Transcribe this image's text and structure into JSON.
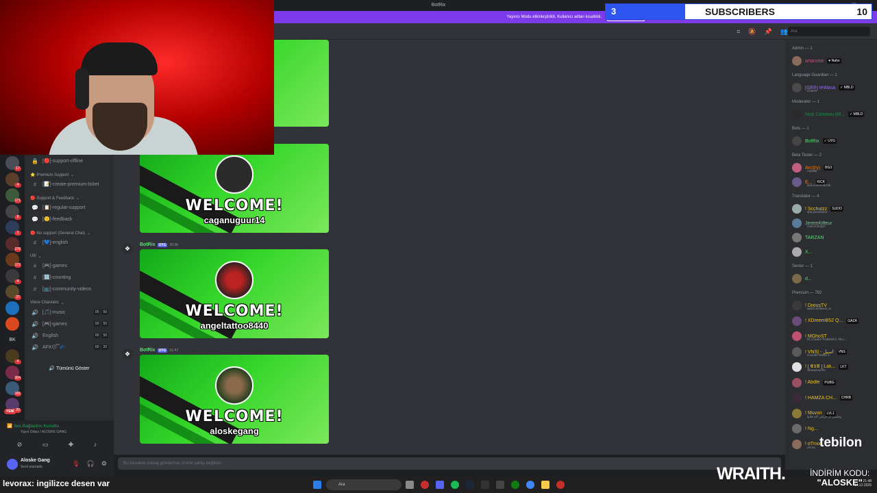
{
  "window": {
    "title": "BotRix"
  },
  "streamer_banner": {
    "text": "Yayıncı Modu etkinleştirildi. Kullanıcı adları kısaltıldı.",
    "button": "Devre dışı bırak"
  },
  "subs_overlay": {
    "current": "3",
    "label": "SUBSCRIBERS",
    "goal": "10",
    "progress_fraction": 0.3,
    "fill_color": "#2f55f0"
  },
  "webcam": {
    "name": "webcam-feed"
  },
  "server_rail": {
    "servers": [
      {
        "badge": "17"
      },
      {
        "badge": "4"
      },
      {
        "badge": "171"
      },
      {
        "badge": "8"
      },
      {
        "badge": "1"
      },
      {
        "badge": "278"
      },
      {
        "badge": "172"
      },
      {
        "badge": "4"
      },
      {
        "badge": "37"
      },
      {
        "badge": ""
      },
      {
        "badge": ""
      },
      {
        "initials": "BK"
      },
      {
        "badge": "4"
      },
      {
        "badge": "304"
      },
      {
        "badge": "165"
      },
      {
        "badge": "20"
      }
    ],
    "new_badge": "YENİ"
  },
  "channels": {
    "items": [
      {
        "kind": "channel",
        "icon": "lock-icon",
        "label": "[🔴]-support-offline"
      },
      {
        "kind": "category",
        "label": "⭐-Premium Support"
      },
      {
        "kind": "channel",
        "icon": "hash-icon",
        "label": "[📝]-create-premium-ticket"
      },
      {
        "kind": "category",
        "label": "🔴-Support & Feedback"
      },
      {
        "kind": "channel",
        "icon": "speech-icon",
        "label": "[📋]-regular-support"
      },
      {
        "kind": "channel",
        "icon": "speech-icon",
        "label": "[🙂]-feedback"
      },
      {
        "kind": "category",
        "label": "🔴-No support (General Chat)"
      },
      {
        "kind": "channel",
        "icon": "hash-icon",
        "label": "[💙]-english"
      },
      {
        "kind": "category",
        "label": "Util"
      },
      {
        "kind": "channel",
        "icon": "hash-icon",
        "label": "[🎮]-games"
      },
      {
        "kind": "channel",
        "icon": "hash-icon",
        "label": "[🔢]-counting"
      },
      {
        "kind": "channel",
        "icon": "hash-icon",
        "label": "[📺]-community-videos"
      },
      {
        "kind": "category",
        "label": "Voice Channels"
      },
      {
        "kind": "voice",
        "icon": "speaker-icon",
        "label": "[🎵]-music",
        "a": "00",
        "b": "50"
      },
      {
        "kind": "voice",
        "icon": "speaker-icon",
        "label": "[🎮]-games",
        "a": "00",
        "b": "50"
      },
      {
        "kind": "voice",
        "icon": "speaker-icon",
        "label": "English",
        "a": "00",
        "b": "50"
      },
      {
        "kind": "voice",
        "icon": "speaker-icon",
        "label": "AFK😴💤",
        "a": "00",
        "b": "20"
      }
    ],
    "show_all": "Tümünü Göster"
  },
  "user_panel": {
    "voice_status": "Ses Bağlantısı Kuruldu",
    "voice_channel": "Yayın Odası / ALOSKE GANG",
    "username": "Aloske Gang",
    "status": "Sesli aramada"
  },
  "chat": {
    "search_placeholder": "Ara",
    "messages": [
      {
        "author": "",
        "app": "",
        "time": "",
        "welcome": "WELCOME!",
        "user": "caganuguur14"
      },
      {
        "author": "BotRix",
        "app": "UYG",
        "time": "20:36",
        "welcome": "WELCOME!",
        "user": "angeltattoo8440"
      },
      {
        "author": "BotRix",
        "app": "UYG",
        "time": "21:47",
        "welcome": "WELCOME!",
        "user": "aloskegang"
      }
    ],
    "composer_placeholder": "Bu kanalda mesaj gönderme iznine sahip değilsin."
  },
  "members": {
    "groups": [
      {
        "title": "Admin — 1",
        "rows": [
          {
            "name": "artanime",
            "tag": "♥ Naho",
            "color": "#e0487a"
          }
        ]
      },
      {
        "title": "Language Guardian — 1",
        "rows": [
          {
            "name": "[GER] leWasa",
            "tag": "✓ MBLD",
            "color": "#9a6cf0",
            "sub": "Cheers"
          }
        ]
      },
      {
        "title": "Moderator — 1",
        "rows": [
          {
            "name": "Nick Comeau (M...",
            "tag": "✓ MBLD",
            "color": "#1f8b4c"
          }
        ]
      },
      {
        "title": "Bots — 1",
        "rows": [
          {
            "name": "BotRix",
            "tag": "✓ UYG",
            "color": "#5ddc7a"
          }
        ]
      },
      {
        "title": "Beta Tester — 2",
        "rows": [
          {
            "name": "Arc(l/y)",
            "tag": "BG3",
            "color": "#e67e22",
            "sub": "royality"
          },
          {
            "name": "E...",
            "tag": "KICK",
            "color": "#e67e22",
            "sub": "kick.com/eddi24k"
          }
        ]
      },
      {
        "title": "Translator — 4",
        "rows": [
          {
            "name": "! Scchutzz",
            "tag": "SUDO",
            "color": "#f1c40f",
            "sub": "vpa.pinoebat.tr"
          },
          {
            "name": "JeremKiffeur",
            "tag": "",
            "color": "#5ddc7a",
            "sub": "Call of Duty®"
          },
          {
            "name": "TARZAN",
            "tag": "",
            "color": "#5ddc7a"
          },
          {
            "name": "X...",
            "tag": "",
            "color": "#5ddc7a"
          }
        ]
      },
      {
        "title": "Senior — 1",
        "rows": [
          {
            "name": "d...",
            "tag": "",
            "color": "#5ddc7a"
          }
        ]
      },
      {
        "title": "Premium — 792",
        "rows": [
          {
            "name": "! DixiusTV",
            "tag": "",
            "color": "#f1c40f",
            "sub": "twitch.tv/dixius_tv"
          },
          {
            "name": "! XDreemB52 Q...",
            "tag": "GAZA",
            "color": "#f1c40f"
          },
          {
            "name": "! MGhoST",
            "tag": "",
            "color": "#f1c40f",
            "sub": "#1 Creator PUBGM in Tik t..."
          },
          {
            "name": "! VNS| - اسيل",
            "tag": "VNS",
            "color": "#f1c40f",
            "sub": "Counter-Strike 2"
          },
          {
            "name": "! [ 𝕰𝕿𝖀 ] Lak...",
            "tag": "LKT",
            "color": "#f1c40f",
            "sub": "Streamnut flo"
          },
          {
            "name": "! Abdle",
            "tag": "PUBG",
            "color": "#f1c40f"
          },
          {
            "name": "! HAMZA CH...",
            "tag": "CHRB",
            "color": "#f1c40f"
          },
          {
            "name": "! Muvxn",
            "tag": "LVL1",
            "color": "#f1c40f",
            "sub": "وحلمنی از حرامی الاه قالوا"
          },
          {
            "name": "! Ng...",
            "tag": "",
            "color": "#f1c40f"
          },
          {
            "name": "! oTnxx",
            "tag": "",
            "color": "#f1c40f",
            "sub": "oTnxx"
          }
        ]
      }
    ]
  },
  "ticker": {
    "nick": "levorax",
    "text": ": ingilizce desen var"
  },
  "taskbar": {
    "search": "Ara",
    "clock_time": "21:48",
    "clock_date": "14.12.2025"
  },
  "sponsors": {
    "tebilon": "tebilon",
    "wraith": "WRAITH.",
    "promo_line1": "İNDİRİM KODU:",
    "promo_line2": "\"ALOSKE\""
  }
}
